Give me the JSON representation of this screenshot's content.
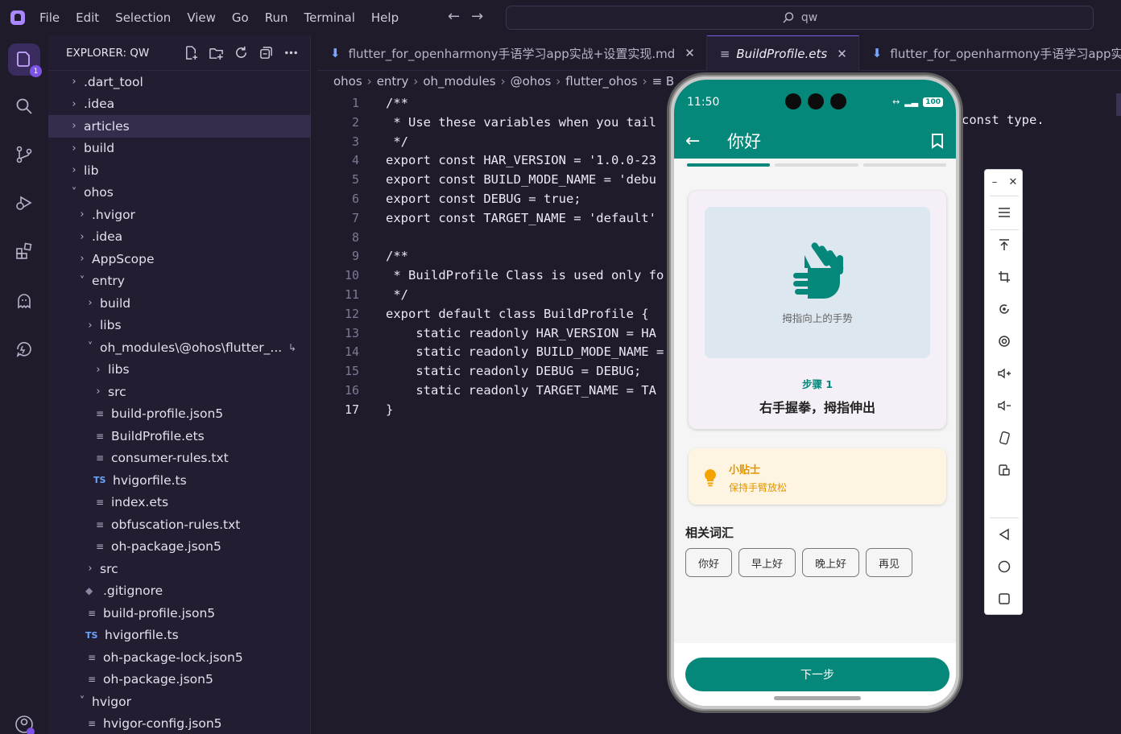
{
  "menu": [
    "File",
    "Edit",
    "Selection",
    "View",
    "Go",
    "Run",
    "Terminal",
    "Help"
  ],
  "search": {
    "text": "qw"
  },
  "activity": {
    "badge": "1"
  },
  "explorer": {
    "title": "EXPLORER: QW",
    "items": [
      {
        "label": ".dart_tool",
        "type": "folder",
        "open": false,
        "depth": 0
      },
      {
        "label": ".idea",
        "type": "folder",
        "open": false,
        "depth": 0
      },
      {
        "label": "articles",
        "type": "folder",
        "open": false,
        "depth": 0,
        "selected": true
      },
      {
        "label": "build",
        "type": "folder",
        "open": false,
        "depth": 0
      },
      {
        "label": "lib",
        "type": "folder",
        "open": false,
        "depth": 0
      },
      {
        "label": "ohos",
        "type": "folder",
        "open": true,
        "depth": 0
      },
      {
        "label": ".hvigor",
        "type": "folder",
        "open": false,
        "depth": 1
      },
      {
        "label": ".idea",
        "type": "folder",
        "open": false,
        "depth": 1
      },
      {
        "label": "AppScope",
        "type": "folder",
        "open": false,
        "depth": 1
      },
      {
        "label": "entry",
        "type": "folder",
        "open": true,
        "depth": 1
      },
      {
        "label": "build",
        "type": "folder",
        "open": false,
        "depth": 2
      },
      {
        "label": "libs",
        "type": "folder",
        "open": false,
        "depth": 2
      },
      {
        "label": "oh_modules\\@ohos\\flutter_...",
        "type": "folder",
        "open": true,
        "depth": 2,
        "link": true
      },
      {
        "label": "libs",
        "type": "folder",
        "open": false,
        "depth": 3
      },
      {
        "label": "src",
        "type": "folder",
        "open": false,
        "depth": 3
      },
      {
        "label": "build-profile.json5",
        "type": "file",
        "depth": 3
      },
      {
        "label": "BuildProfile.ets",
        "type": "file",
        "depth": 3
      },
      {
        "label": "consumer-rules.txt",
        "type": "file",
        "depth": 3
      },
      {
        "label": "hvigorfile.ts",
        "type": "ts",
        "depth": 3
      },
      {
        "label": "index.ets",
        "type": "file",
        "depth": 3
      },
      {
        "label": "obfuscation-rules.txt",
        "type": "file",
        "depth": 3
      },
      {
        "label": "oh-package.json5",
        "type": "file",
        "depth": 3
      },
      {
        "label": "src",
        "type": "folder",
        "open": false,
        "depth": 2
      },
      {
        "label": ".gitignore",
        "type": "git",
        "depth": 2
      },
      {
        "label": "build-profile.json5",
        "type": "file",
        "depth": 2
      },
      {
        "label": "hvigorfile.ts",
        "type": "ts",
        "depth": 2
      },
      {
        "label": "oh-package-lock.json5",
        "type": "file",
        "depth": 2
      },
      {
        "label": "oh-package.json5",
        "type": "file",
        "depth": 2
      },
      {
        "label": "hvigor",
        "type": "folder",
        "open": true,
        "depth": 1
      },
      {
        "label": "hvigor-config.json5",
        "type": "file",
        "depth": 2
      }
    ]
  },
  "tabs": [
    {
      "label": "flutter_for_openharmony手语学习app实战+设置实现.md",
      "active": false
    },
    {
      "label": "BuildProfile.ets",
      "active": true
    },
    {
      "label": "flutter_for_openharmony手语学习app实战",
      "active": false
    }
  ],
  "breadcrumb": [
    "ohos",
    "entry",
    "oh_modules",
    "@ohos",
    "flutter_ohos",
    "B"
  ],
  "code": {
    "lines": [
      "/**",
      " * Use these variables when you tail",
      " */",
      "export const HAR_VERSION = '1.0.0-23",
      "export const BUILD_MODE_NAME = 'debu",
      "export const DEBUG = true;",
      "export const TARGET_NAME = 'default'",
      "",
      "/**",
      " * BuildProfile Class is used only fo",
      " */",
      "export default class BuildProfile {",
      "    static readonly HAR_VERSION = HA",
      "    static readonly BUILD_MODE_NAME =",
      "    static readonly DEBUG = DEBUG;",
      "    static readonly TARGET_NAME = TA",
      "}"
    ],
    "current_line": 17,
    "tail_text": "const type."
  },
  "phone": {
    "time": "11:50",
    "battery": "100",
    "app_title": "你好",
    "progress_segments": 3,
    "progress_done": 1,
    "image_caption": "拇指向上的手势",
    "step_label": "步骤 1",
    "step_text": "右手握拳，拇指伸出",
    "tip_title": "小贴士",
    "tip_body": "保持手臂放松",
    "related_title": "相关词汇",
    "related_words": [
      "你好",
      "早上好",
      "晚上好",
      "再见"
    ],
    "next_button": "下一步",
    "colors": {
      "primary": "#05877a",
      "tip": "#e39500"
    }
  },
  "emulator_toolbar": [
    "minimize",
    "close",
    "menu",
    "pin-top",
    "crop",
    "rotate",
    "screenshot",
    "volume-up",
    "volume-down",
    "shake",
    "fold",
    "back",
    "home",
    "recents"
  ]
}
